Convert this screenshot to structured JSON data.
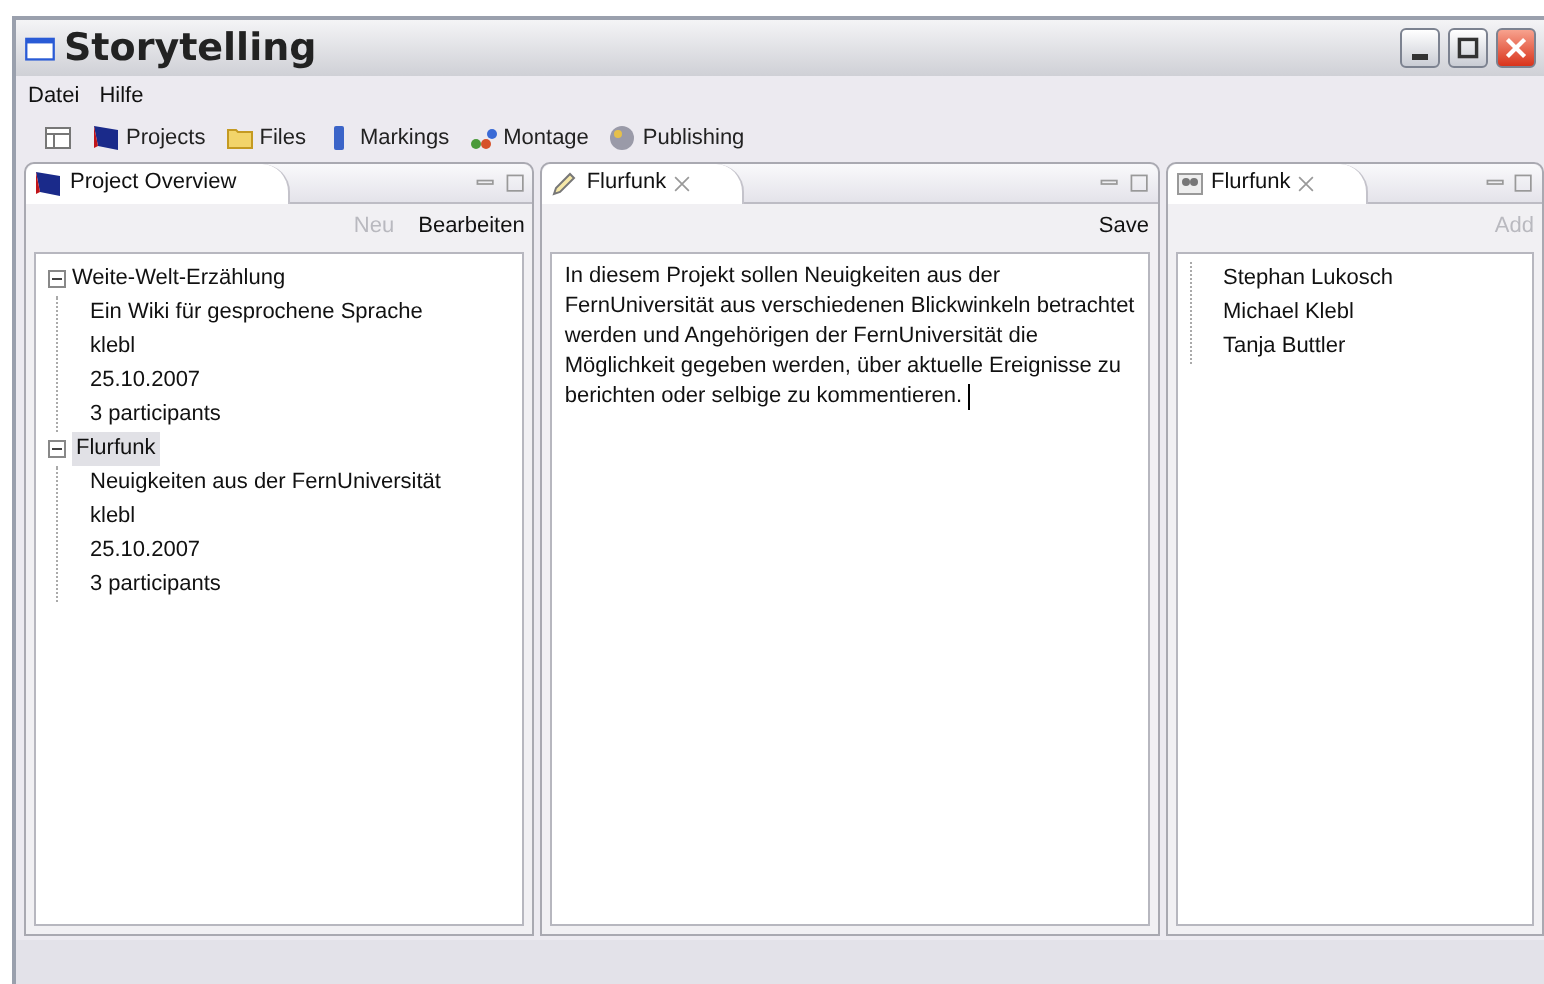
{
  "window": {
    "title": "Storytelling"
  },
  "menu": [
    {
      "label": "Datei"
    },
    {
      "label": "Hilfe"
    }
  ],
  "toolbar": [
    {
      "kind": "layout"
    },
    {
      "kind": "projects",
      "label": "Projects"
    },
    {
      "kind": "files",
      "label": "Files"
    },
    {
      "kind": "markings",
      "label": "Markings"
    },
    {
      "kind": "montage",
      "label": "Montage"
    },
    {
      "kind": "publishing",
      "label": "Publishing"
    }
  ],
  "panels": [
    {
      "kind": "tree",
      "tab": {
        "title": "Project Overview",
        "closable": false
      },
      "actions": [
        {
          "label": "Neu",
          "disabled": true
        },
        {
          "label": "Bearbeiten",
          "disabled": false
        }
      ],
      "tree": [
        {
          "label": "Weite-Welt-Erzählung",
          "expanded": true,
          "selected": false,
          "children": [
            {
              "label": "Ein Wiki für gesprochene Sprache"
            },
            {
              "label": "klebl"
            },
            {
              "label": "25.10.2007"
            },
            {
              "label": "3 participants"
            }
          ]
        },
        {
          "label": "Flurfunk",
          "expanded": true,
          "selected": true,
          "children": [
            {
              "label": "Neuigkeiten aus der FernUniversität"
            },
            {
              "label": "klebl"
            },
            {
              "label": "25.10.2007"
            },
            {
              "label": "3 participants"
            }
          ]
        }
      ]
    },
    {
      "kind": "editor",
      "tab": {
        "title": "Flurfunk",
        "closable": true
      },
      "actions": [
        {
          "label": "Save",
          "disabled": false
        }
      ],
      "text": "In diesem Projekt sollen  Neuigkeiten aus der FernUniversität aus verschiedenen Blickwinkeln betrachtet werden und Angehörigen der FernUniversität die Möglichkeit gegeben werden, über aktuelle Ereignisse zu berichten oder selbige zu kommentieren. "
    },
    {
      "kind": "list",
      "tab": {
        "title": "Flurfunk",
        "closable": true
      },
      "actions": [
        {
          "label": "Add",
          "disabled": true
        }
      ],
      "items": [
        {
          "label": "Stephan Lukosch"
        },
        {
          "label": "Michael Klebl"
        },
        {
          "label": "Tanja Buttler"
        }
      ]
    }
  ]
}
